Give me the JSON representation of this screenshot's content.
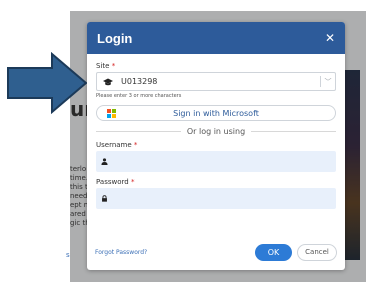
{
  "background": {
    "title_fragment": "ur",
    "text_lines": [
      "terlo",
      "time.",
      "this t",
      "need",
      "ept m",
      "ared",
      "gic th"
    ],
    "link_fragment": "s"
  },
  "modal": {
    "title": "Login",
    "close_icon": "close-icon",
    "site": {
      "label": "Site",
      "required_mark": "*",
      "value": "U013298",
      "icon": "graduation-cap-icon",
      "chevron": "chevron-down-icon",
      "hint": "Please enter 3 or more characters"
    },
    "microsoft_button": {
      "label": "Sign in with Microsoft",
      "icon": "microsoft-logo-icon"
    },
    "divider_text": "Or log in using",
    "username": {
      "label": "Username",
      "required_mark": "*",
      "value": "",
      "icon": "user-icon"
    },
    "password": {
      "label": "Password",
      "required_mark": "*",
      "value": "",
      "icon": "lock-icon"
    },
    "forgot_link": "Forgot Password?",
    "ok_label": "OK",
    "cancel_label": "Cancel"
  },
  "colors": {
    "header": "#2d5b9a",
    "primary_button": "#2d7bd6",
    "input_background": "#e8f0fb",
    "arrow": "#2f5f8f",
    "required": "#d42020"
  }
}
